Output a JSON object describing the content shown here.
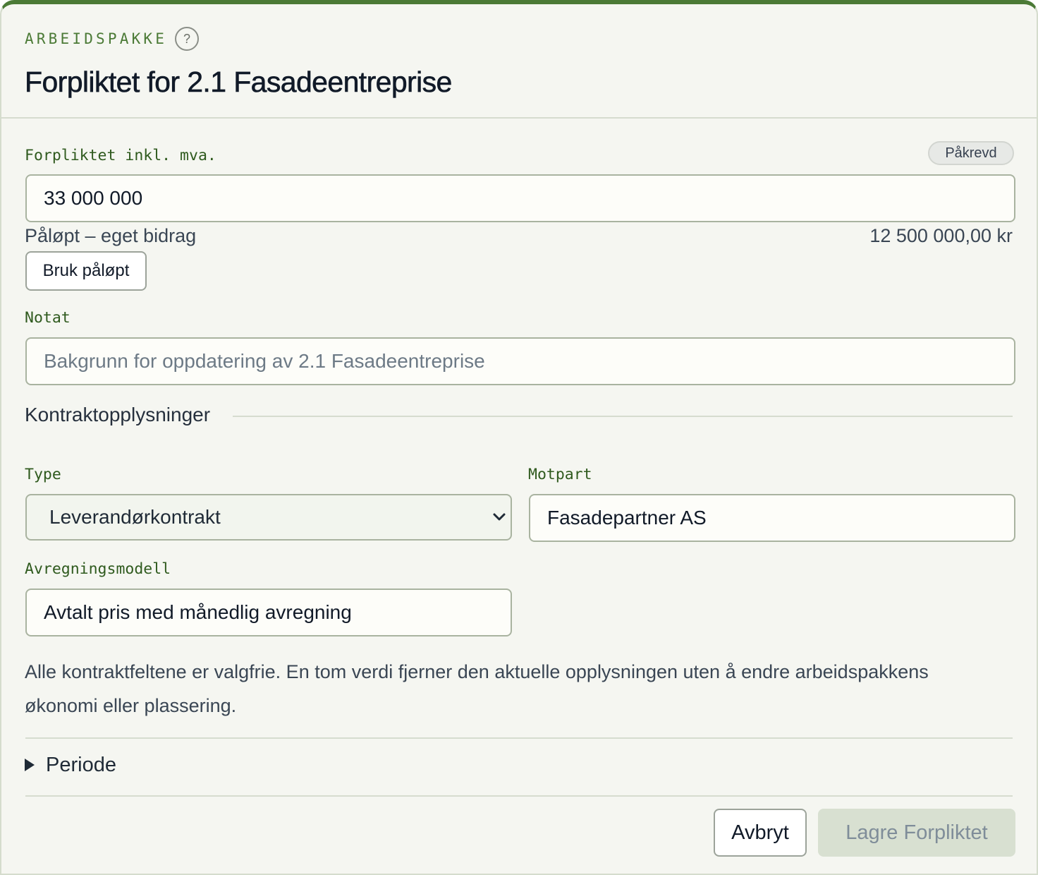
{
  "header": {
    "eyebrow": "ARBEIDSPAKKE",
    "help_glyph": "?",
    "title": "Forpliktet for 2.1 Fasadeentreprise"
  },
  "commitment": {
    "label": "Forpliktet inkl. mva.",
    "required_badge": "Påkrevd",
    "value": "33 000 000",
    "accrued_label": "Påløpt – eget bidrag",
    "accrued_amount": "12 500 000,00 kr",
    "use_accrued_button": "Bruk påløpt"
  },
  "note": {
    "label": "Notat",
    "value": "",
    "placeholder": "Bakgrunn for oppdatering av 2.1 Fasadeentreprise"
  },
  "contract": {
    "heading": "Kontraktopplysninger",
    "type_label": "Type",
    "type_value": "Leverandørkontrakt",
    "counterparty_label": "Motpart",
    "counterparty_value": "Fasadepartner AS",
    "settlement_label": "Avregningsmodell",
    "settlement_value": "Avtalt pris med månedlig avregning",
    "help_text": "Alle kontraktfeltene er valgfrie. En tom verdi fjerner den aktuelle opplysningen uten å endre arbeidspakkens økonomi eller plassering."
  },
  "period": {
    "label": "Periode",
    "expanded": false
  },
  "footer": {
    "cancel_label": "Avbryt",
    "save_label": "Lagre Forpliktet",
    "save_enabled": false
  },
  "icons": {
    "help": "question-circle-icon",
    "select": "chevron-down-icon",
    "disclosure": "triangle-right-icon"
  },
  "colors": {
    "accent": "#4b7a36",
    "label_green": "#2f5a1e",
    "background": "#f5f6f1",
    "primary_disabled_bg": "#d8e0d1",
    "primary_disabled_text": "#7f8d99"
  }
}
